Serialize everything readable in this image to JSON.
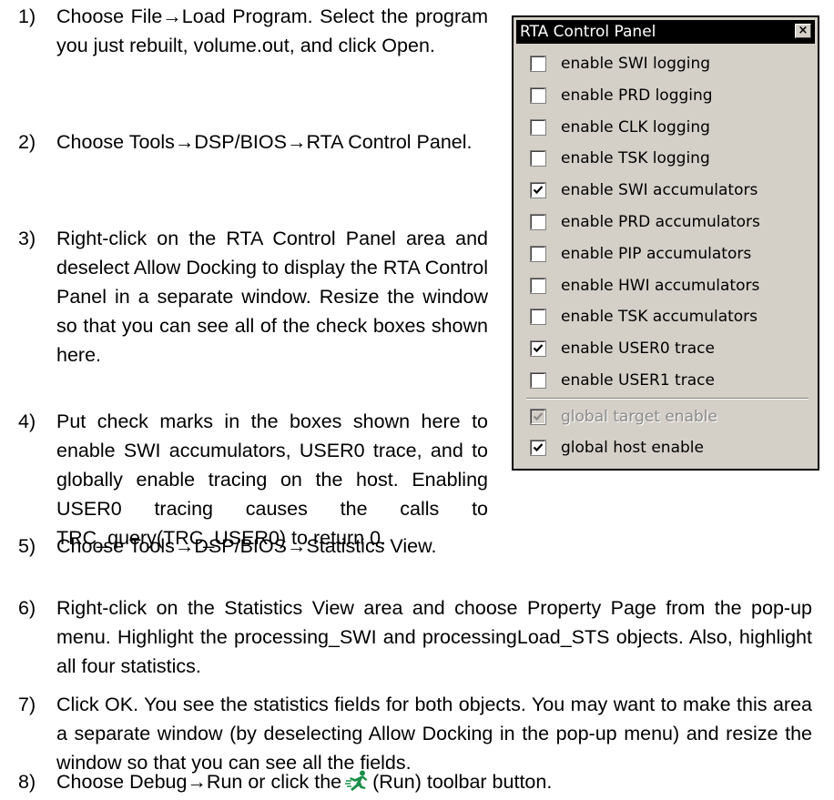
{
  "steps": [
    {
      "num": "1)",
      "text": "Choose File→Load Program. Select the program you just rebuilt, volume.out, and click Open."
    },
    {
      "num": "2)",
      "text": "Choose Tools→DSP/BIOS→RTA Control Panel."
    },
    {
      "num": "3)",
      "text": "Right-click on the RTA Control Panel area and deselect Allow Docking to display the RTA Control Panel in a separate window. Resize the window so that you can see all of the check boxes shown here."
    },
    {
      "num": "4)",
      "text": "Put check marks in the boxes shown here to enable SWI accumulators, USER0 trace, and to globally enable tracing on the host. Enabling USER0 tracing causes the calls to TRC_query(TRC_USER0) to return 0."
    },
    {
      "num": "5)",
      "text": "Choose Tools→DSP/BIOS→Statistics View."
    },
    {
      "num": "6)",
      "text": "Right-click on the Statistics View area and choose Property Page from the pop-up menu. Highlight the processing_SWI and processingLoad_STS objects. Also, highlight all four statistics."
    },
    {
      "num": "7)",
      "text": "Click OK. You see the statistics fields for both objects. You may want to make this area a separate window (by deselecting Allow Docking in the pop-up menu) and resize the window so that you can see all the fields."
    },
    {
      "num": "8)",
      "text_before": "Choose Debug→Run or click the",
      "text_after": "(Run) toolbar button.",
      "icon": "run-icon"
    }
  ],
  "rta_panel": {
    "title": "RTA Control Panel",
    "close_label": "×",
    "options": [
      {
        "label": "enable SWI logging",
        "checked": false,
        "enabled": true
      },
      {
        "label": "enable PRD logging",
        "checked": false,
        "enabled": true
      },
      {
        "label": "enable CLK logging",
        "checked": false,
        "enabled": true
      },
      {
        "label": "enable TSK logging",
        "checked": false,
        "enabled": true
      },
      {
        "label": "enable SWI accumulators",
        "checked": true,
        "enabled": true
      },
      {
        "label": "enable PRD accumulators",
        "checked": false,
        "enabled": true
      },
      {
        "label": "enable PIP accumulators",
        "checked": false,
        "enabled": true
      },
      {
        "label": "enable HWI accumulators",
        "checked": false,
        "enabled": true
      },
      {
        "label": "enable TSK accumulators",
        "checked": false,
        "enabled": true
      },
      {
        "label": "enable USER0 trace",
        "checked": true,
        "enabled": true
      },
      {
        "label": "enable USER1 trace",
        "checked": false,
        "enabled": true
      }
    ],
    "global_options": [
      {
        "label": "global target enable",
        "checked": true,
        "enabled": false
      },
      {
        "label": "global host enable",
        "checked": true,
        "enabled": true
      }
    ]
  }
}
